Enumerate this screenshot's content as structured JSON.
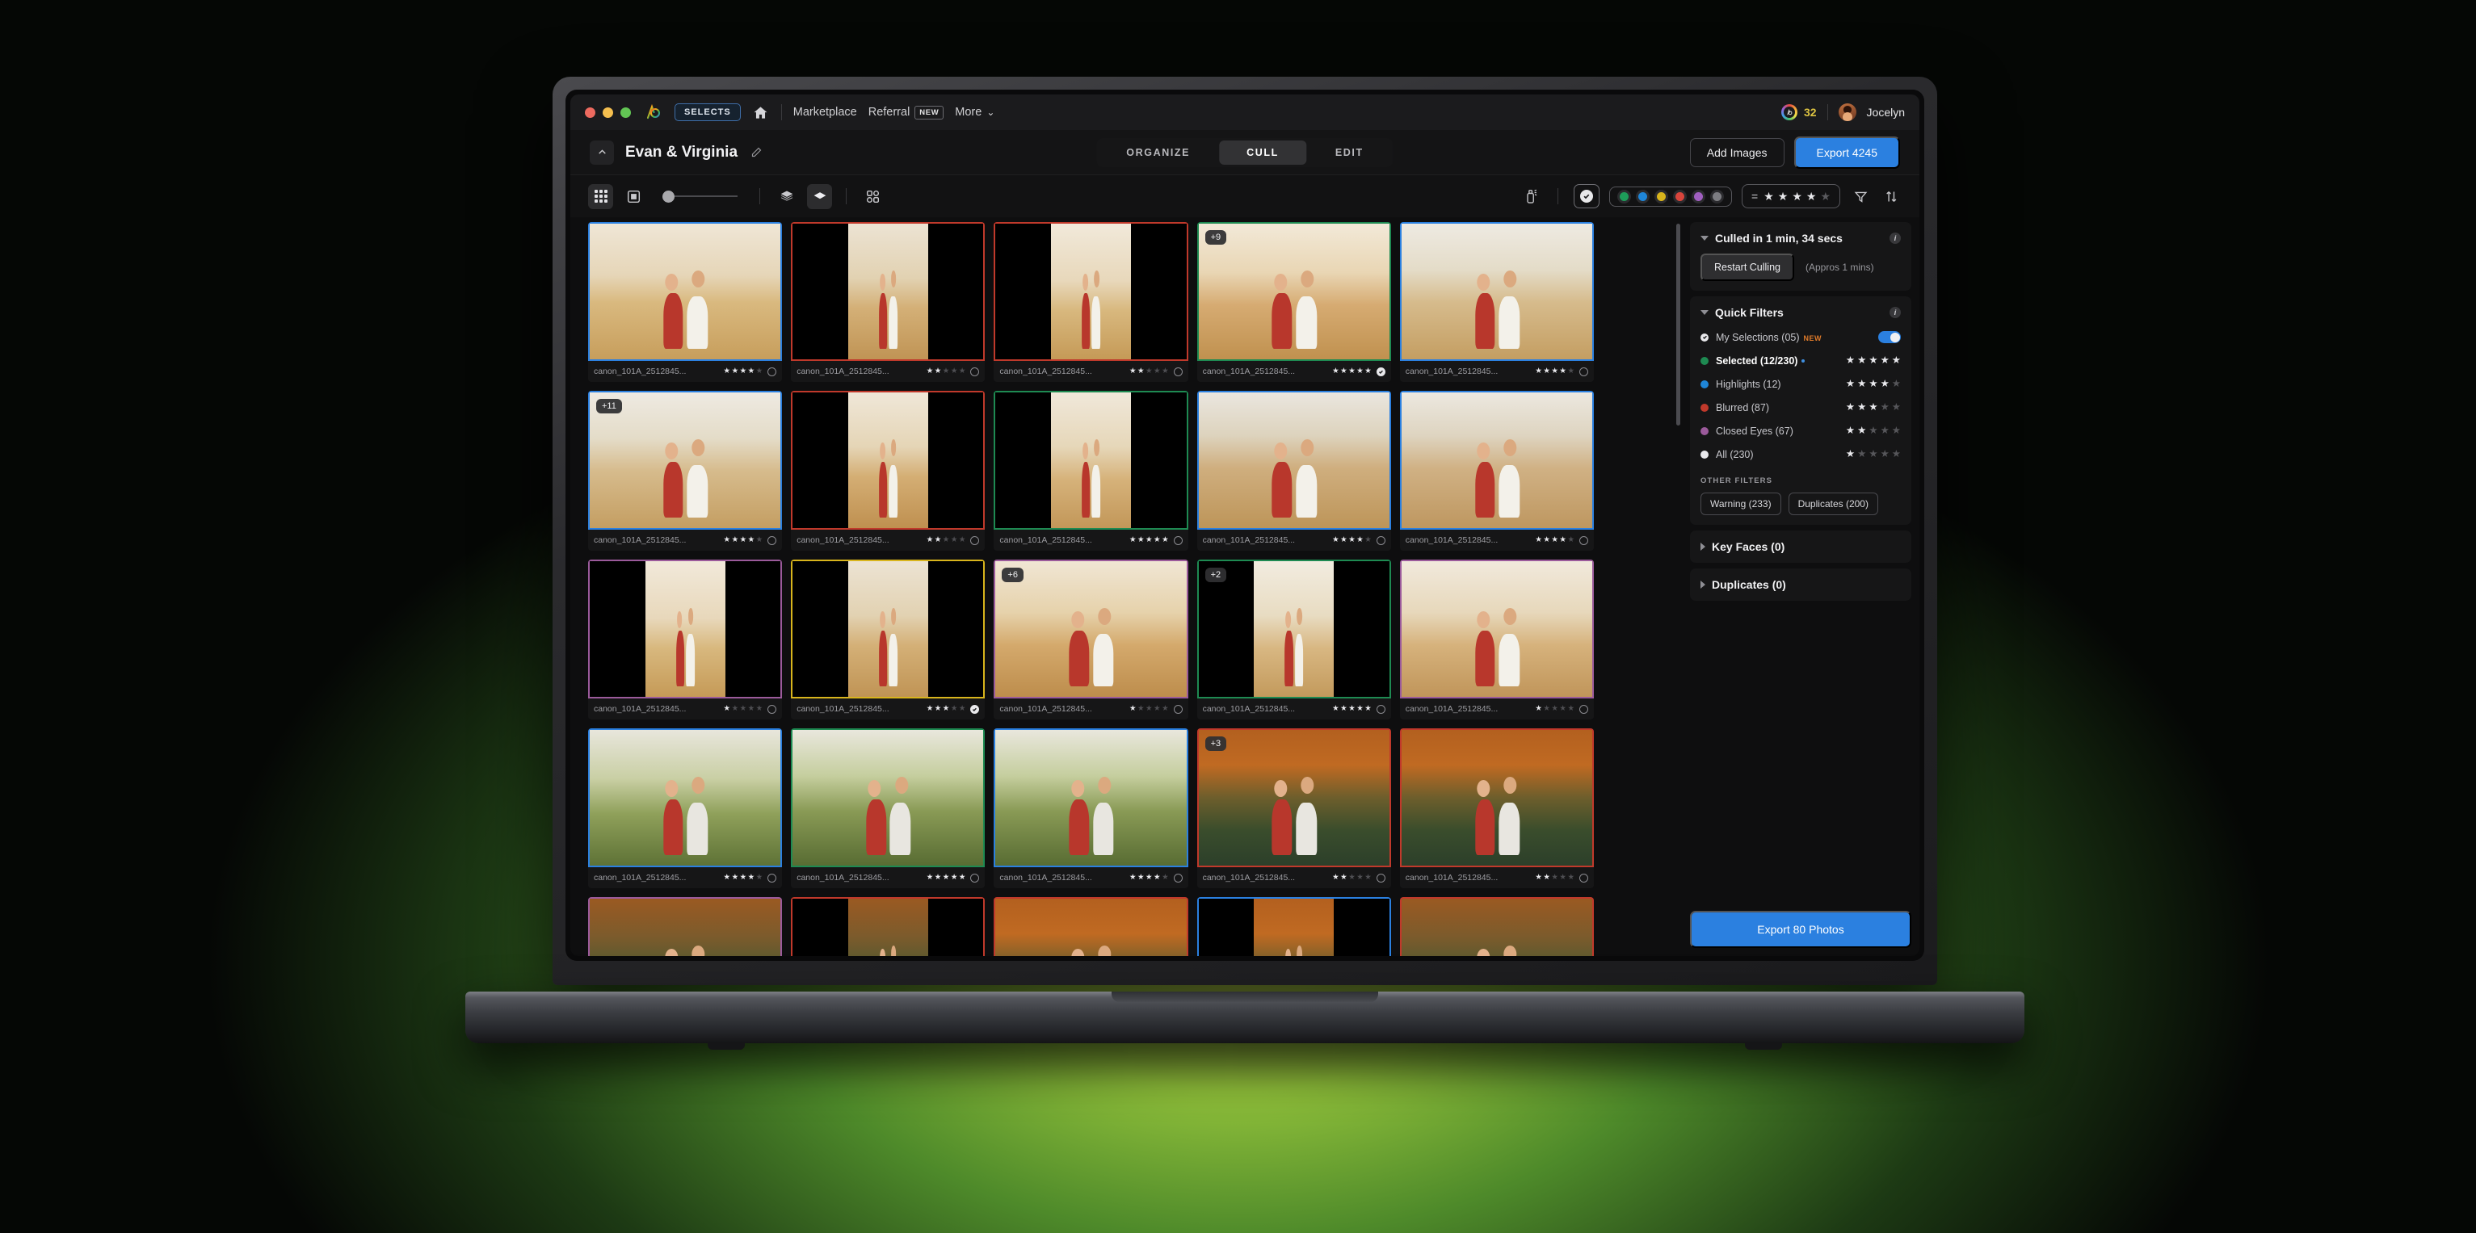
{
  "titlebar": {
    "selects_badge": "SELECTS",
    "nav": [
      {
        "label": "Marketplace",
        "tag": null
      },
      {
        "label": "Referral",
        "tag": "NEW"
      },
      {
        "label": "More",
        "tag": null
      }
    ],
    "more_caret": "⌄",
    "credits": "32",
    "username": "Jocelyn"
  },
  "subheader": {
    "project_title": "Evan & Virginia",
    "modes": [
      {
        "label": "ORGANIZE",
        "active": false
      },
      {
        "label": "CULL",
        "active": true
      },
      {
        "label": "EDIT",
        "active": false
      }
    ],
    "add_images": "Add Images",
    "export": "Export 4245"
  },
  "toolbar": {
    "color_swatches": [
      "#1e9c5a",
      "#1f86d8",
      "#d8b41c",
      "#d9453c",
      "#a05fc0",
      "#7d7d82"
    ],
    "rating_filter": {
      "equals": "=",
      "stars": 4,
      "max": 5
    }
  },
  "panel": {
    "culled": {
      "title": "Culled in 1 min, 34 secs",
      "restart_label": "Restart Culling",
      "approx": "(Appros 1 mins)"
    },
    "quick_filters": {
      "title": "Quick Filters",
      "other_filters_label": "OTHER FILTERS",
      "items": [
        {
          "label": "My Selections (05)",
          "tag": "NEW",
          "color": "#e9e9ec",
          "type": "check",
          "toggle": true,
          "stars": null
        },
        {
          "label": "Selected (12/230)",
          "dot_suffix": true,
          "color": "#1e8a52",
          "type": "dot",
          "stars": 5,
          "strong": true
        },
        {
          "label": "Highlights (12)",
          "color": "#1f86d8",
          "type": "dot",
          "stars": 4
        },
        {
          "label": "Blurred (87)",
          "color": "#c0392b",
          "type": "dot",
          "stars": 3
        },
        {
          "label": "Closed Eyes (67)",
          "color": "#9b5a9b",
          "type": "dot",
          "stars": 2
        },
        {
          "label": "All (230)",
          "color": "#e9e9ec",
          "type": "dot",
          "stars": 1
        }
      ],
      "chips": [
        "Warning (233)",
        "Duplicates (200)"
      ]
    },
    "key_faces": {
      "title": "Key Faces (0)"
    },
    "duplicates": {
      "title": "Duplicates (0)"
    },
    "export_button": "Export 80 Photos"
  },
  "grid": {
    "filename": "canon_101A_2512845...",
    "items": [
      {
        "border": "#2b80e0",
        "stars": 4,
        "selected": false,
        "badge": null,
        "scene": "a",
        "wide": true
      },
      {
        "border": "#c0392b",
        "stars": 2,
        "selected": false,
        "badge": null,
        "scene": "b",
        "wide": false
      },
      {
        "border": "#c0392b",
        "stars": 2,
        "selected": false,
        "badge": null,
        "scene": "c",
        "wide": false
      },
      {
        "border": "#1e8a52",
        "stars": 5,
        "selected": true,
        "badge": "+9",
        "scene": "d",
        "wide": true
      },
      {
        "border": "#2b80e0",
        "stars": 4,
        "selected": false,
        "badge": null,
        "scene": "e",
        "wide": true
      },
      {
        "border": "#2b80e0",
        "stars": 4,
        "selected": false,
        "badge": "+11",
        "scene": "e",
        "wide": true
      },
      {
        "border": "#c0392b",
        "stars": 2,
        "selected": false,
        "badge": null,
        "scene": "f",
        "wide": false
      },
      {
        "border": "#1e8a52",
        "stars": 5,
        "selected": false,
        "badge": null,
        "scene": "g",
        "wide": false
      },
      {
        "border": "#2b80e0",
        "stars": 4,
        "selected": false,
        "badge": null,
        "scene": "h",
        "wide": true
      },
      {
        "border": "#2b80e0",
        "stars": 4,
        "selected": false,
        "badge": null,
        "scene": "i",
        "wide": true
      },
      {
        "border": "#9b5a9b",
        "stars": 1,
        "selected": false,
        "badge": null,
        "scene": "c",
        "wide": false
      },
      {
        "border": "#d8b41c",
        "stars": 3,
        "selected": true,
        "badge": null,
        "scene": "b",
        "wide": false
      },
      {
        "border": "#9b5a9b",
        "stars": 1,
        "selected": false,
        "badge": "+6",
        "scene": "j",
        "wide": true
      },
      {
        "border": "#1e8a52",
        "stars": 5,
        "selected": false,
        "badge": "+2",
        "scene": "k",
        "wide": false
      },
      {
        "border": "#9b5a9b",
        "stars": 1,
        "selected": false,
        "badge": null,
        "scene": "l",
        "wide": true
      },
      {
        "border": "#2b80e0",
        "stars": 4,
        "selected": false,
        "badge": null,
        "scene": "m",
        "wide": true
      },
      {
        "border": "#1e8a52",
        "stars": 5,
        "selected": false,
        "badge": null,
        "scene": "n",
        "wide": true
      },
      {
        "border": "#2b80e0",
        "stars": 4,
        "selected": false,
        "badge": null,
        "scene": "n",
        "wide": true
      },
      {
        "border": "#c0392b",
        "stars": 2,
        "selected": false,
        "badge": "+3",
        "scene": "o",
        "wide": true
      },
      {
        "border": "#c0392b",
        "stars": 2,
        "selected": false,
        "badge": null,
        "scene": "o",
        "wide": true
      },
      {
        "border": "#9b5a9b",
        "stars": 0,
        "selected": false,
        "badge": null,
        "scene": "p",
        "wide": true
      },
      {
        "border": "#c0392b",
        "stars": 0,
        "selected": false,
        "badge": null,
        "scene": "p",
        "wide": false
      },
      {
        "border": "#c0392b",
        "stars": 0,
        "selected": false,
        "badge": null,
        "scene": "o",
        "wide": true
      },
      {
        "border": "#2b80e0",
        "stars": 0,
        "selected": false,
        "badge": null,
        "scene": "o",
        "wide": false
      },
      {
        "border": "#c0392b",
        "stars": 0,
        "selected": false,
        "badge": null,
        "scene": "p",
        "wide": true
      }
    ]
  }
}
